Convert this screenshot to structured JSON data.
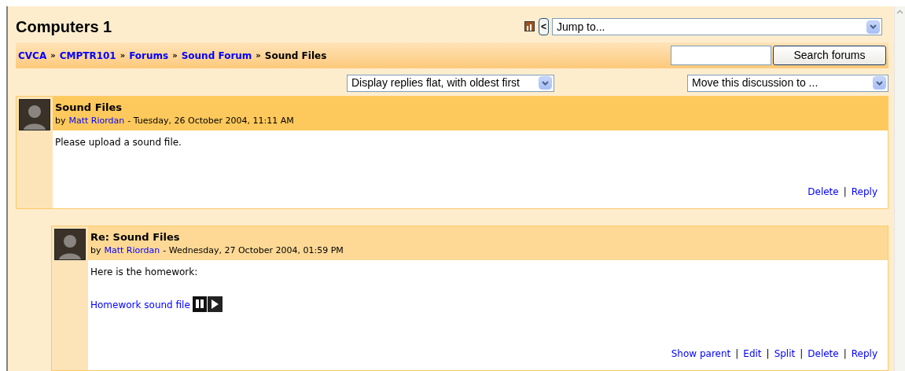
{
  "course_title": "Computers 1",
  "jump_menu": {
    "prev_button": "<",
    "value": "Jump to..."
  },
  "breadcrumb": [
    {
      "kind": "link",
      "text": "CVCA"
    },
    {
      "kind": "separator",
      "text": "»"
    },
    {
      "kind": "link",
      "text": "CMPTR101"
    },
    {
      "kind": "separator",
      "text": "»"
    },
    {
      "kind": "link",
      "text": "Forums"
    },
    {
      "kind": "separator",
      "text": "»"
    },
    {
      "kind": "link",
      "text": "Sound Forum"
    },
    {
      "kind": "separator",
      "text": "»"
    },
    {
      "kind": "current",
      "text": "Sound Files"
    }
  ],
  "search": {
    "button": "Search forums"
  },
  "display_mode": {
    "value": "Display replies flat, with oldest first"
  },
  "move_discussion": {
    "value": "Move this discussion to ..."
  },
  "posts": [
    {
      "kind": "first",
      "subject": "Sound Files",
      "by": "by",
      "author": "Matt Riordan",
      "date": "- Tuesday, 26 October 2004, 11:11 AM",
      "body": [
        {
          "kind": "text",
          "text": "Please upload a sound file."
        }
      ],
      "commands": [
        {
          "kind": "link",
          "text": "Delete"
        },
        {
          "kind": "separator",
          "text": "|"
        },
        {
          "kind": "link",
          "text": "Reply"
        }
      ]
    },
    {
      "kind": "reply",
      "subject": "Re: Sound Files",
      "by": "by",
      "author": "Matt Riordan",
      "date": "- Wednesday, 27 October 2004, 01:59 PM",
      "body": [
        {
          "kind": "text",
          "text": "Here is the homework:"
        },
        {
          "kind": "media",
          "text": "Homework sound file"
        }
      ],
      "commands": [
        {
          "kind": "link",
          "text": "Show parent"
        },
        {
          "kind": "separator",
          "text": "|"
        },
        {
          "kind": "link",
          "text": "Edit"
        },
        {
          "kind": "separator",
          "text": "|"
        },
        {
          "kind": "link",
          "text": "Split"
        },
        {
          "kind": "separator",
          "text": "|"
        },
        {
          "kind": "link",
          "text": "Delete"
        },
        {
          "kind": "separator",
          "text": "|"
        },
        {
          "kind": "link",
          "text": "Reply"
        }
      ]
    }
  ]
}
